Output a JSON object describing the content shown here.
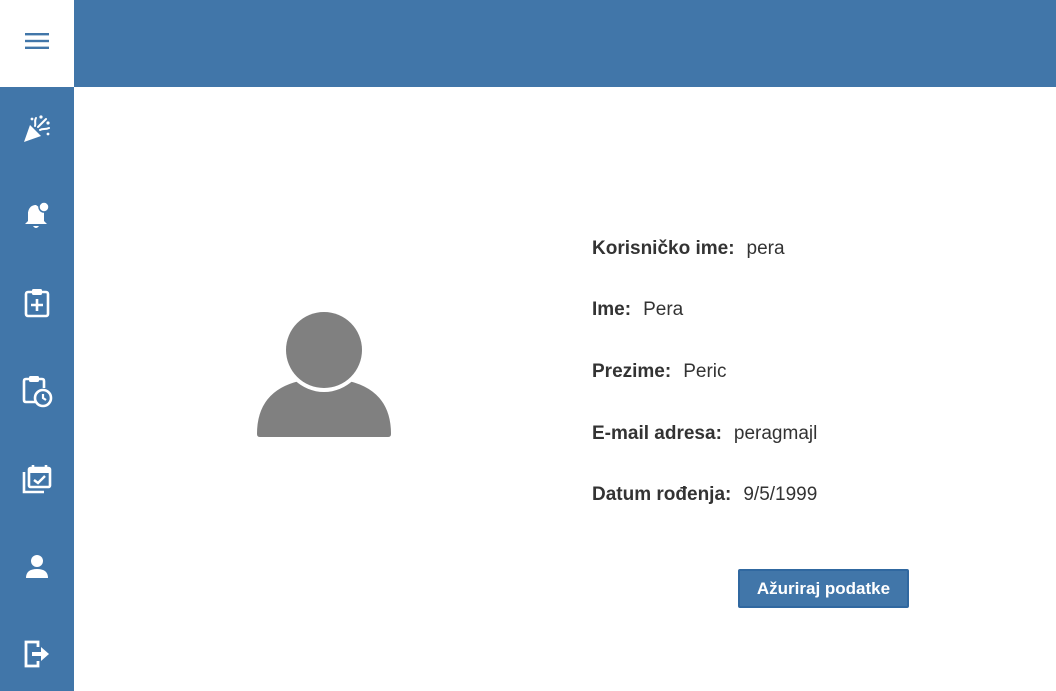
{
  "colors": {
    "accent": "#4176a9",
    "icon_white": "#ffffff",
    "avatar_gray": "#808080",
    "text": "#333333"
  },
  "header": {
    "menu_icon": "hamburger-menu-icon"
  },
  "sidebar": {
    "items": [
      {
        "icon": "party-popper-icon"
      },
      {
        "icon": "notification-bell-icon"
      },
      {
        "icon": "clipboard-plus-icon"
      },
      {
        "icon": "clipboard-clock-icon"
      },
      {
        "icon": "calendar-check-icon"
      },
      {
        "icon": "user-icon"
      },
      {
        "icon": "logout-icon"
      }
    ]
  },
  "profile": {
    "avatar_icon": "user-avatar-icon",
    "fields": [
      {
        "label": "Korisničko ime:",
        "value": "pera"
      },
      {
        "label": "Ime:",
        "value": "Pera"
      },
      {
        "label": "Prezime:",
        "value": "Peric"
      },
      {
        "label": "E-mail adresa:",
        "value": "peragmajl"
      },
      {
        "label": "Datum rođenja:",
        "value": "9/5/1999"
      }
    ],
    "update_button": "Ažuriraj podatke"
  }
}
